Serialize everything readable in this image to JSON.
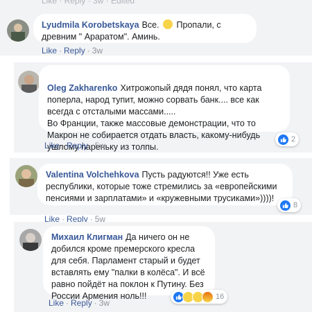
{
  "top": {
    "meta": "Like · Reply · 3w · Edited"
  },
  "comments": [
    {
      "author": "Lyudmila Korobetskaya",
      "text_before": "Все.",
      "text_after": "Пропали, с древним \" Араратом\". Аминь.",
      "like_label": "Like",
      "reply_label": "Reply",
      "time": "3w",
      "reactions": null
    },
    {
      "author": "Oleg Zakharenko",
      "text": "Хитрожопый дядя понял, что карта поперла, народ тупит, можно сорвать банк.... все как всегда с отсталыми массами.....\nВо Франции, также массовые демонстрации, что то Макрон не собирается отдать власть, какому-нибудь ушлому пареньку из толпы.",
      "like_label": "Like",
      "reply_label": "Reply",
      "time": "5w",
      "reactions": "2"
    },
    {
      "author": "Valentina Volchehkova",
      "text": "Пусть радуются!! Уже есть республики, которые тоже стремились за «европейскими пенсиями и зарплатами» и «кружевными трусиками»))))!",
      "like_label": "Like",
      "reply_label": "Reply",
      "time": "5w",
      "reactions": "8"
    },
    {
      "author": "Михаил Клигман",
      "text": "Да ничего он не добился кроме премерского кресла для себя. Парламент старый и будет вставлять ему \"палки в колёса\". И всё равно пойдёт на поклон к Путину. Без России Армения ноль!!!",
      "like_label": "Like",
      "reply_label": "Reply",
      "time": "3w",
      "reactions": "16"
    }
  ],
  "colors": {
    "panel_bg": "#f2f3f5",
    "link": "#385898",
    "muted": "#90949c",
    "like_blue": "#2078f4"
  }
}
